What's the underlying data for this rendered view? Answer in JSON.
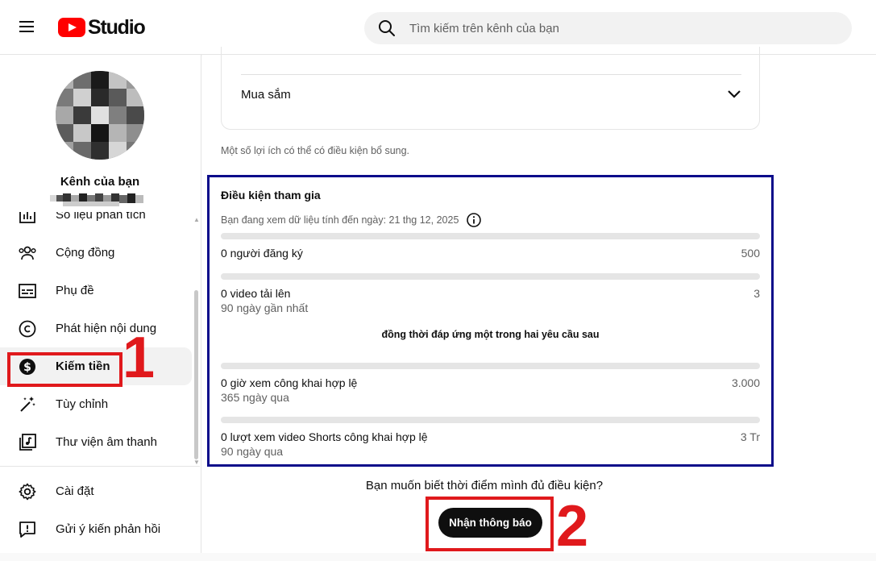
{
  "header": {
    "logo_text": "Studio",
    "search_placeholder": "Tìm kiếm trên kênh của bạn"
  },
  "sidebar": {
    "channel_label": "Kênh của bạn",
    "items": [
      {
        "label": "Số liệu phân tích",
        "icon": "analytics-icon"
      },
      {
        "label": "Cộng đồng",
        "icon": "community-icon"
      },
      {
        "label": "Phụ đề",
        "icon": "subtitles-icon"
      },
      {
        "label": "Phát hiện nội dung",
        "icon": "copyright-icon"
      },
      {
        "label": "Kiếm tiền",
        "icon": "monetization-icon",
        "active": true
      },
      {
        "label": "Tùy chỉnh",
        "icon": "customization-icon"
      },
      {
        "label": "Thư viện âm thanh",
        "icon": "audio-library-icon"
      }
    ],
    "bottom_items": [
      {
        "label": "Cài đặt",
        "icon": "gear-icon"
      },
      {
        "label": "Gửi ý kiến phản hồi",
        "icon": "feedback-icon"
      }
    ]
  },
  "main": {
    "shopping_label": "Mua sắm",
    "benefit_note": "Một số lợi ích có thể có điều kiện bổ sung.",
    "eligibility": {
      "title": "Điều kiện tham gia",
      "as_of": "Bạn đang xem dữ liệu tính đến ngày: 21 thg 12, 2025",
      "requirements": [
        {
          "label": "0 người đăng ký",
          "target": "500",
          "sub": "",
          "progress": 0
        },
        {
          "label": "0 video tải lên",
          "target": "3",
          "sub": "90 ngày gần nhất",
          "progress": 0
        },
        {
          "label": "0 giờ xem công khai hợp lệ",
          "target": "3.000",
          "sub": "365 ngày qua",
          "progress": 0
        },
        {
          "label": "0 lượt xem video Shorts công khai hợp lệ",
          "target": "3 Tr",
          "sub": "90 ngày qua",
          "progress": 0
        }
      ],
      "or_text": "đồng thời đáp ứng một trong hai yêu cầu sau"
    },
    "question": "Bạn muốn biết thời điểm mình đủ điều kiện?",
    "notify_button": "Nhận thông báo"
  },
  "annotations": {
    "step1": "1",
    "step2": "2",
    "box_blue": "#0b0b8a",
    "box_red": "#e0191c"
  }
}
